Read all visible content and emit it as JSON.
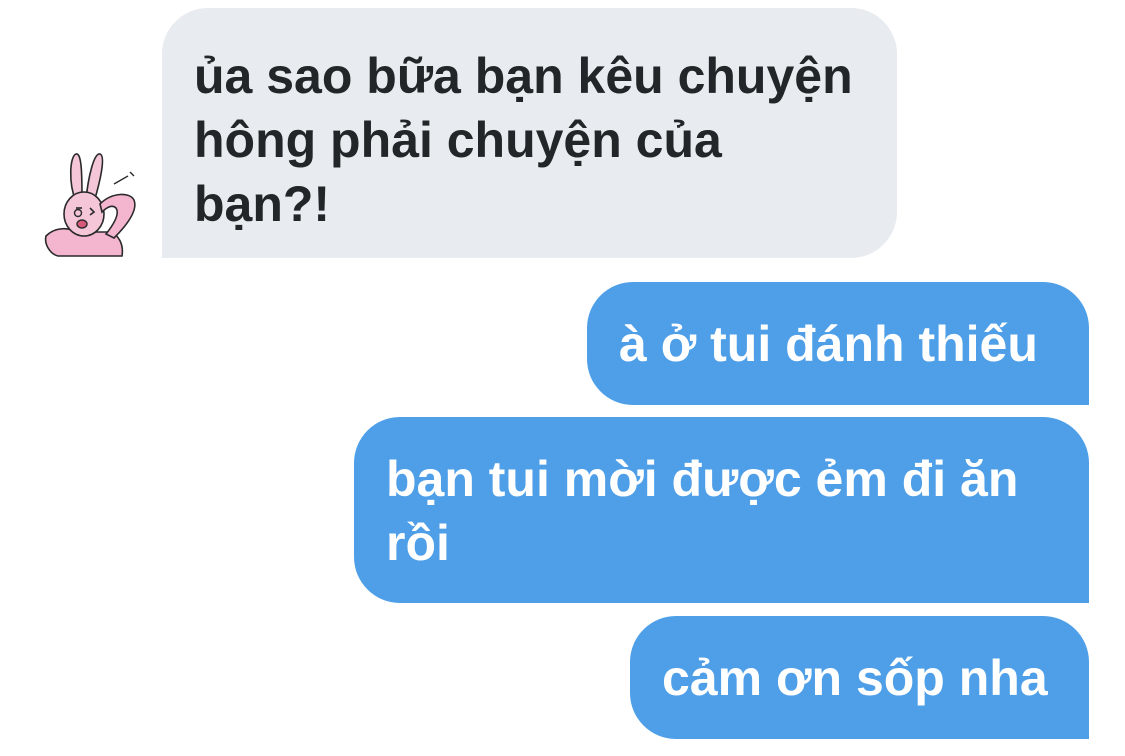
{
  "conversation": {
    "messages": [
      {
        "sender": "them",
        "text": "ủa sao bữa bạn kêu chuyện hông phải chuyện của bạn?!"
      },
      {
        "sender": "me",
        "text": "à ở tui đánh thiếu"
      },
      {
        "sender": "me",
        "text": "bạn tui mời được ẻm đi ăn rồi"
      },
      {
        "sender": "me",
        "text": "cảm ơn sốp nha"
      }
    ]
  },
  "avatar": {
    "icon": "bunny-sticker-icon"
  },
  "colors": {
    "incoming_bubble": "#e8ebef",
    "incoming_text": "#222629",
    "outgoing_bubble": "#4e9fe8",
    "outgoing_text": "#ffffff"
  }
}
